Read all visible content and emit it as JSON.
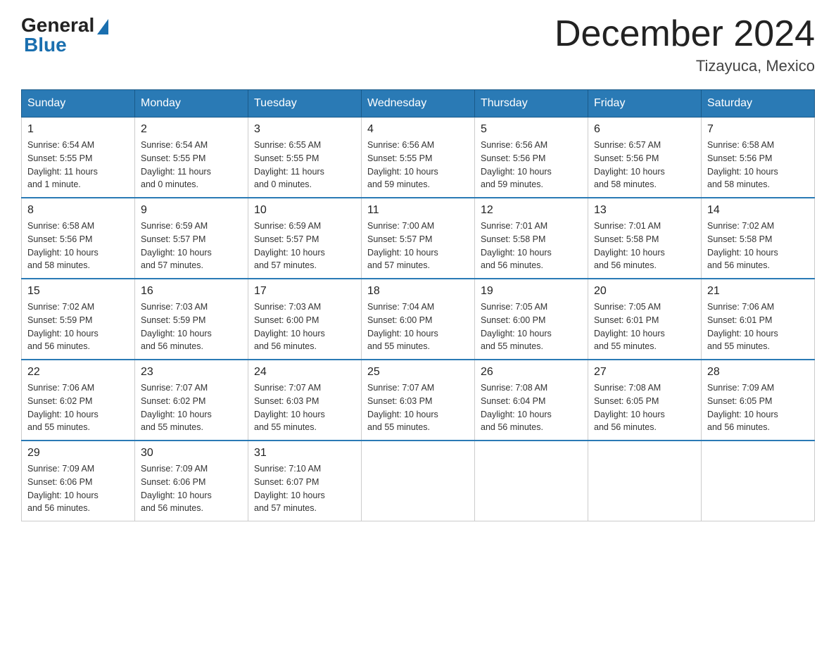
{
  "logo": {
    "general": "General",
    "blue": "Blue"
  },
  "title": "December 2024",
  "location": "Tizayuca, Mexico",
  "headers": [
    "Sunday",
    "Monday",
    "Tuesday",
    "Wednesday",
    "Thursday",
    "Friday",
    "Saturday"
  ],
  "weeks": [
    [
      {
        "day": "1",
        "info": "Sunrise: 6:54 AM\nSunset: 5:55 PM\nDaylight: 11 hours\nand 1 minute."
      },
      {
        "day": "2",
        "info": "Sunrise: 6:54 AM\nSunset: 5:55 PM\nDaylight: 11 hours\nand 0 minutes."
      },
      {
        "day": "3",
        "info": "Sunrise: 6:55 AM\nSunset: 5:55 PM\nDaylight: 11 hours\nand 0 minutes."
      },
      {
        "day": "4",
        "info": "Sunrise: 6:56 AM\nSunset: 5:55 PM\nDaylight: 10 hours\nand 59 minutes."
      },
      {
        "day": "5",
        "info": "Sunrise: 6:56 AM\nSunset: 5:56 PM\nDaylight: 10 hours\nand 59 minutes."
      },
      {
        "day": "6",
        "info": "Sunrise: 6:57 AM\nSunset: 5:56 PM\nDaylight: 10 hours\nand 58 minutes."
      },
      {
        "day": "7",
        "info": "Sunrise: 6:58 AM\nSunset: 5:56 PM\nDaylight: 10 hours\nand 58 minutes."
      }
    ],
    [
      {
        "day": "8",
        "info": "Sunrise: 6:58 AM\nSunset: 5:56 PM\nDaylight: 10 hours\nand 58 minutes."
      },
      {
        "day": "9",
        "info": "Sunrise: 6:59 AM\nSunset: 5:57 PM\nDaylight: 10 hours\nand 57 minutes."
      },
      {
        "day": "10",
        "info": "Sunrise: 6:59 AM\nSunset: 5:57 PM\nDaylight: 10 hours\nand 57 minutes."
      },
      {
        "day": "11",
        "info": "Sunrise: 7:00 AM\nSunset: 5:57 PM\nDaylight: 10 hours\nand 57 minutes."
      },
      {
        "day": "12",
        "info": "Sunrise: 7:01 AM\nSunset: 5:58 PM\nDaylight: 10 hours\nand 56 minutes."
      },
      {
        "day": "13",
        "info": "Sunrise: 7:01 AM\nSunset: 5:58 PM\nDaylight: 10 hours\nand 56 minutes."
      },
      {
        "day": "14",
        "info": "Sunrise: 7:02 AM\nSunset: 5:58 PM\nDaylight: 10 hours\nand 56 minutes."
      }
    ],
    [
      {
        "day": "15",
        "info": "Sunrise: 7:02 AM\nSunset: 5:59 PM\nDaylight: 10 hours\nand 56 minutes."
      },
      {
        "day": "16",
        "info": "Sunrise: 7:03 AM\nSunset: 5:59 PM\nDaylight: 10 hours\nand 56 minutes."
      },
      {
        "day": "17",
        "info": "Sunrise: 7:03 AM\nSunset: 6:00 PM\nDaylight: 10 hours\nand 56 minutes."
      },
      {
        "day": "18",
        "info": "Sunrise: 7:04 AM\nSunset: 6:00 PM\nDaylight: 10 hours\nand 55 minutes."
      },
      {
        "day": "19",
        "info": "Sunrise: 7:05 AM\nSunset: 6:00 PM\nDaylight: 10 hours\nand 55 minutes."
      },
      {
        "day": "20",
        "info": "Sunrise: 7:05 AM\nSunset: 6:01 PM\nDaylight: 10 hours\nand 55 minutes."
      },
      {
        "day": "21",
        "info": "Sunrise: 7:06 AM\nSunset: 6:01 PM\nDaylight: 10 hours\nand 55 minutes."
      }
    ],
    [
      {
        "day": "22",
        "info": "Sunrise: 7:06 AM\nSunset: 6:02 PM\nDaylight: 10 hours\nand 55 minutes."
      },
      {
        "day": "23",
        "info": "Sunrise: 7:07 AM\nSunset: 6:02 PM\nDaylight: 10 hours\nand 55 minutes."
      },
      {
        "day": "24",
        "info": "Sunrise: 7:07 AM\nSunset: 6:03 PM\nDaylight: 10 hours\nand 55 minutes."
      },
      {
        "day": "25",
        "info": "Sunrise: 7:07 AM\nSunset: 6:03 PM\nDaylight: 10 hours\nand 55 minutes."
      },
      {
        "day": "26",
        "info": "Sunrise: 7:08 AM\nSunset: 6:04 PM\nDaylight: 10 hours\nand 56 minutes."
      },
      {
        "day": "27",
        "info": "Sunrise: 7:08 AM\nSunset: 6:05 PM\nDaylight: 10 hours\nand 56 minutes."
      },
      {
        "day": "28",
        "info": "Sunrise: 7:09 AM\nSunset: 6:05 PM\nDaylight: 10 hours\nand 56 minutes."
      }
    ],
    [
      {
        "day": "29",
        "info": "Sunrise: 7:09 AM\nSunset: 6:06 PM\nDaylight: 10 hours\nand 56 minutes."
      },
      {
        "day": "30",
        "info": "Sunrise: 7:09 AM\nSunset: 6:06 PM\nDaylight: 10 hours\nand 56 minutes."
      },
      {
        "day": "31",
        "info": "Sunrise: 7:10 AM\nSunset: 6:07 PM\nDaylight: 10 hours\nand 57 minutes."
      },
      {
        "day": "",
        "info": ""
      },
      {
        "day": "",
        "info": ""
      },
      {
        "day": "",
        "info": ""
      },
      {
        "day": "",
        "info": ""
      }
    ]
  ]
}
